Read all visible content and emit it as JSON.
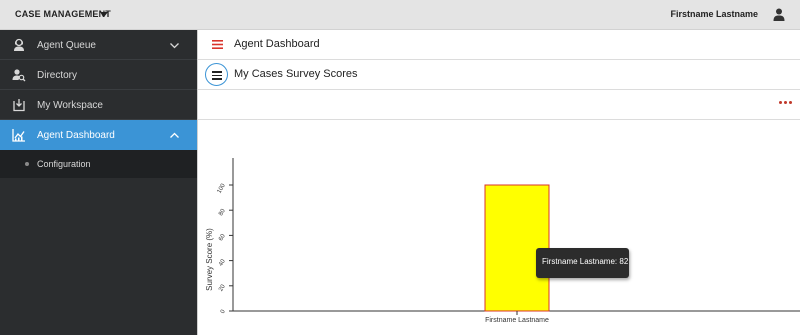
{
  "topbar": {
    "app_title": "CASE MANAGEMENT",
    "user_name": "Firstname Lastname"
  },
  "sidebar": {
    "items": [
      {
        "label": "Agent Queue",
        "icon": "agent-queue-icon",
        "expanded": false
      },
      {
        "label": "Directory",
        "icon": "directory-icon"
      },
      {
        "label": "My Workspace",
        "icon": "workspace-icon"
      },
      {
        "label": "Agent Dashboard",
        "icon": "dashboard-icon",
        "expanded": true,
        "active": true
      }
    ],
    "sub_items": [
      {
        "label": "Configuration"
      }
    ]
  },
  "header": {
    "title": "Agent Dashboard"
  },
  "panel": {
    "title": "My Cases Survey Scores"
  },
  "tooltip": {
    "text": "Firstname Lastname: 82"
  },
  "colors": {
    "accent": "#3b94d6",
    "bar_fill": "#ffff00",
    "bar_stroke": "#d9342b",
    "more_dots": "#c0392b"
  },
  "chart_data": {
    "type": "bar",
    "categories": [
      "Firstname Lastname"
    ],
    "values": [
      100
    ],
    "xlabel": "",
    "ylabel": "Survey Score (%)",
    "ylim": [
      0,
      100
    ],
    "yticks": [
      0,
      20,
      40,
      60,
      80,
      100
    ],
    "grid": false,
    "legend": "none"
  }
}
